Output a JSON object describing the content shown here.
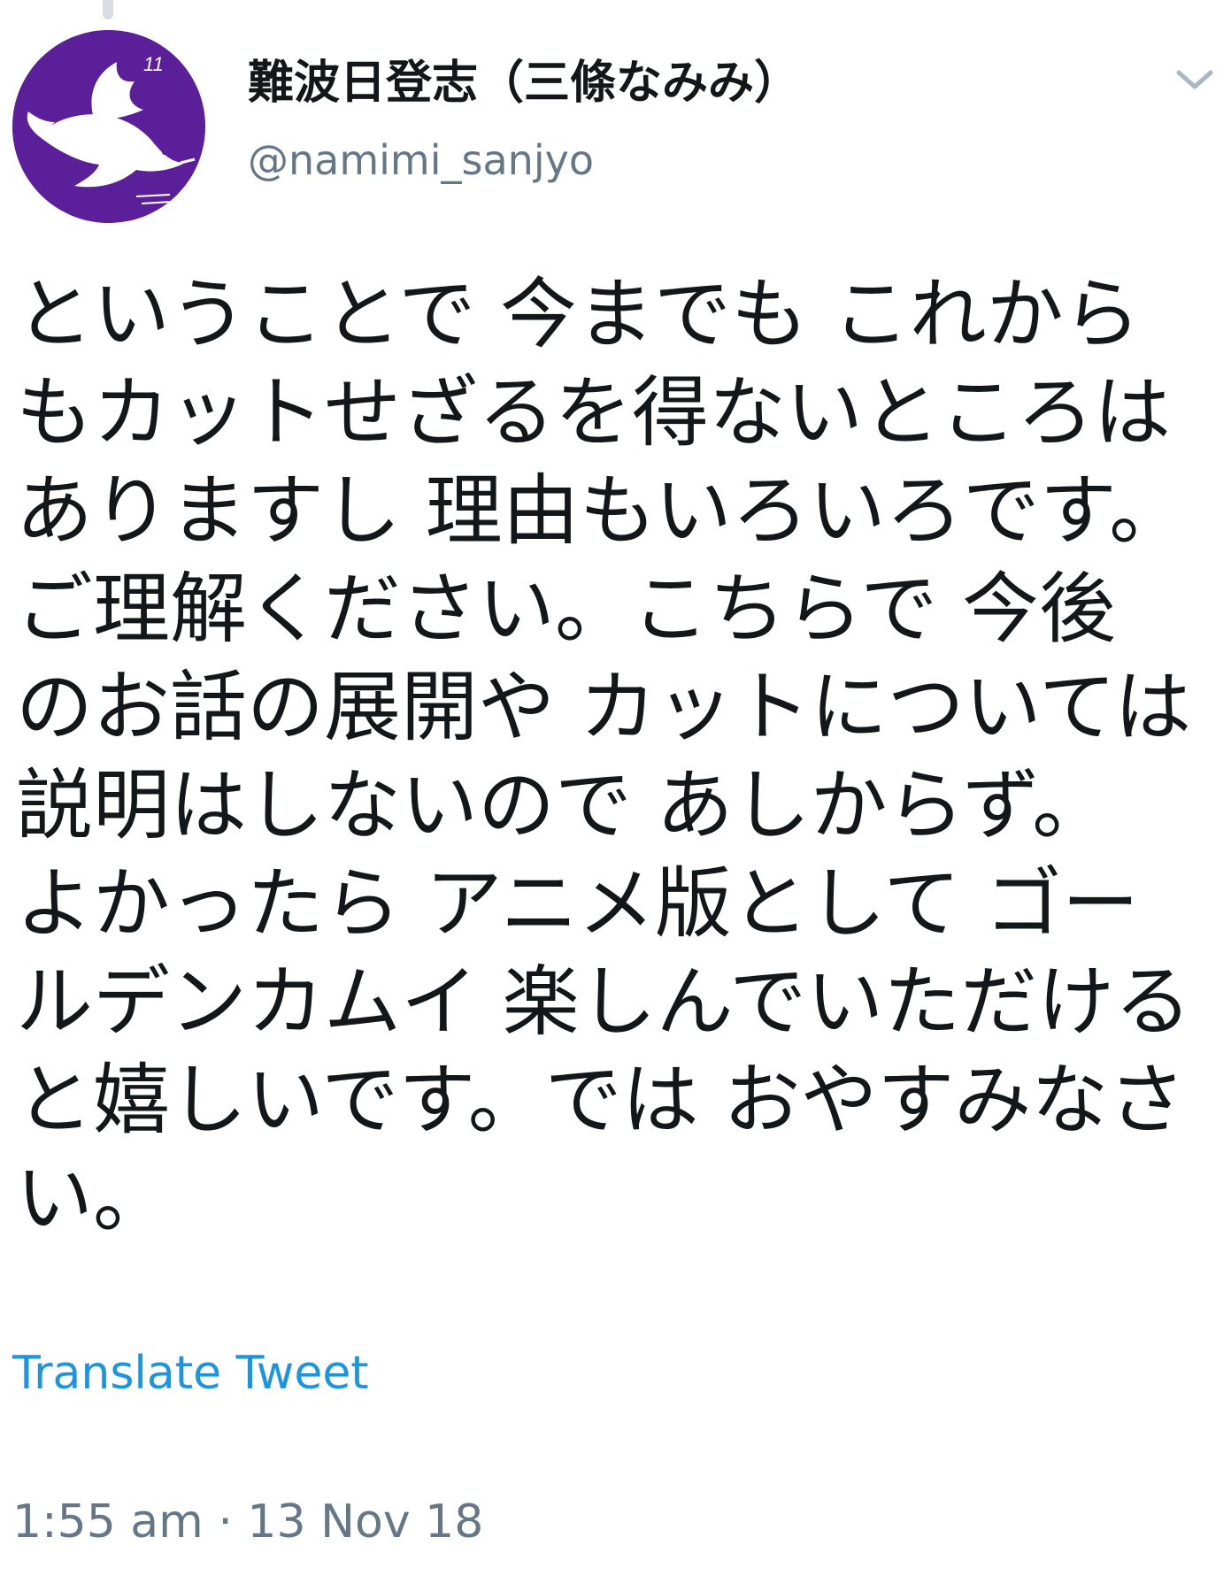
{
  "tweet": {
    "display_name": "難波日登志（三條なみみ）",
    "handle": "@namimi_sanjyo",
    "avatar_badge": "11",
    "body_lines": [
      "ということで 今までも これから",
      "もカットせざるを得ないところは",
      "ありますし 理由もいろいろです。",
      "ご理解ください。こちらで 今後",
      "のお話の展開や カットについては",
      "説明はしないので あしからず。",
      "よかったら アニメ版として ゴー",
      "ルデンカムイ 楽しんでいただける",
      "と嬉しいです。では おやすみなさ",
      "い。"
    ],
    "translate_label": "Translate Tweet",
    "timestamp": "1:55 am · 13 Nov 18"
  },
  "icons": {
    "avatar": "dove-avatar",
    "menu": "chevron-down-icon"
  },
  "colors": {
    "avatar_bg": "#5b1f9a",
    "link": "#1b95e0",
    "secondary_text": "#657786",
    "primary_text": "#14171a"
  }
}
